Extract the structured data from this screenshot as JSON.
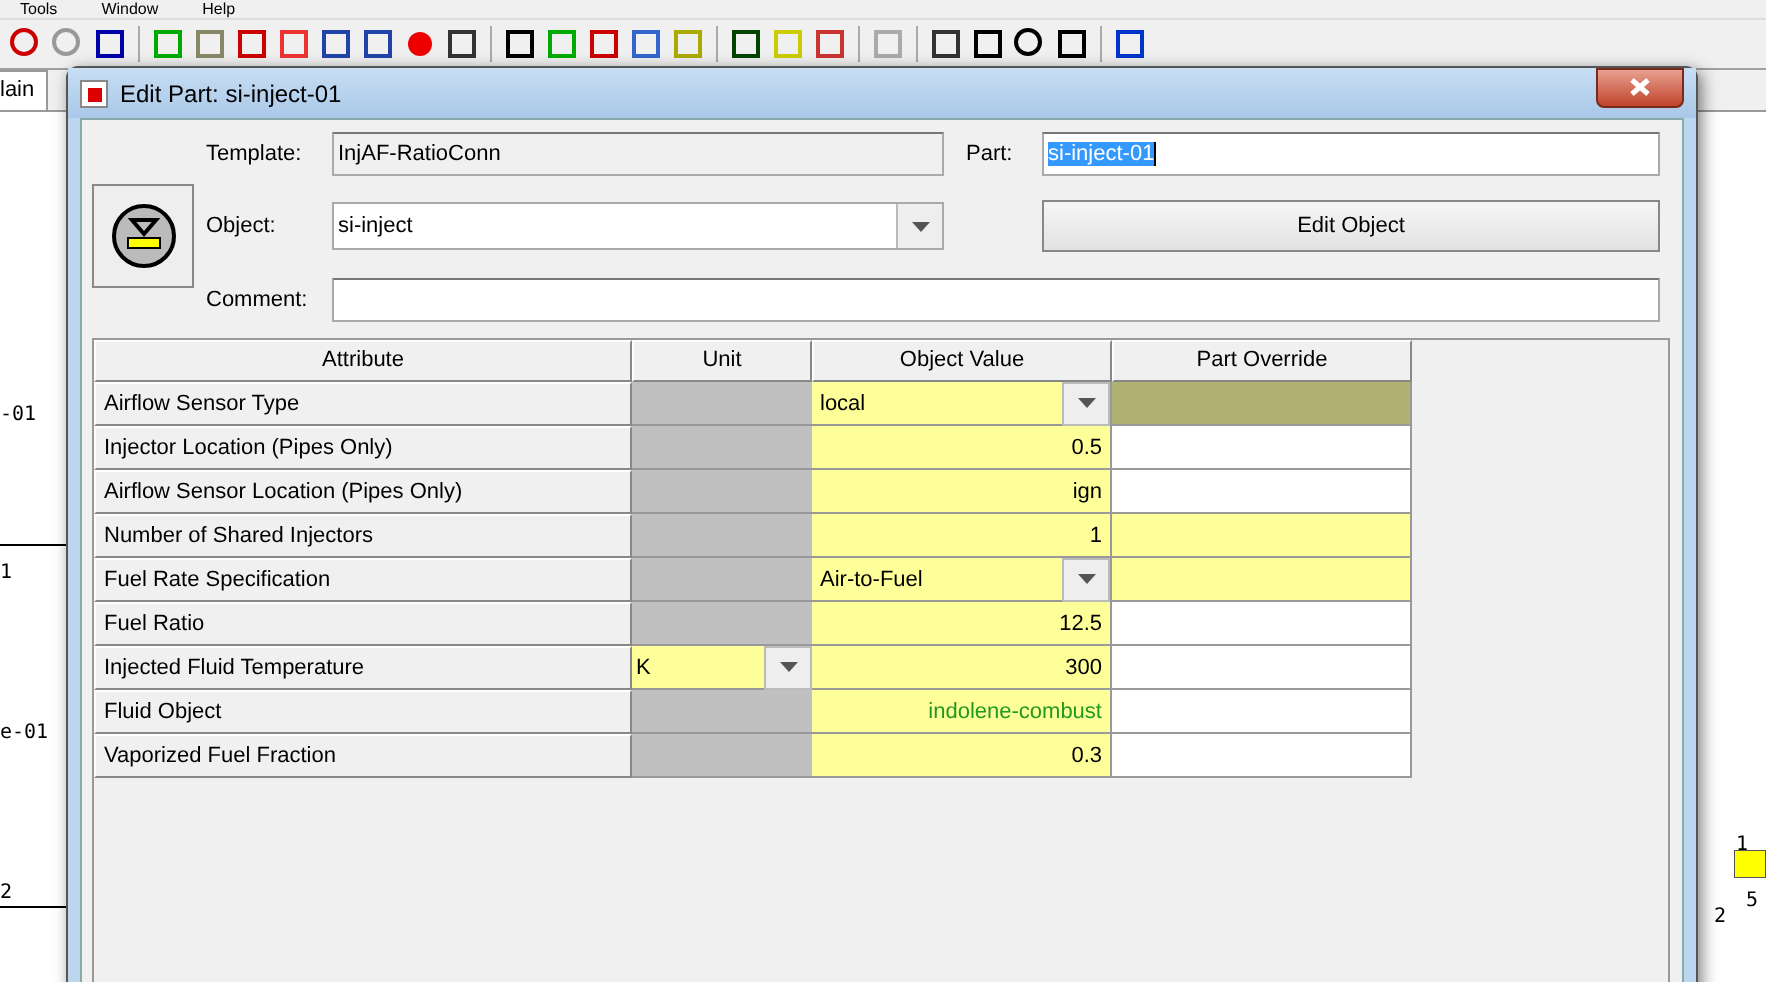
{
  "menu": [
    "Tools",
    "Window",
    "Help"
  ],
  "canvas": {
    "tab": "lain",
    "left_labels": [
      "-01",
      "1",
      "e-01",
      "2"
    ],
    "right_labels": [
      "1",
      "2",
      "5"
    ]
  },
  "dialog": {
    "title": "Edit Part: si-inject-01",
    "template": {
      "label": "Template:",
      "value": "InjAF-RatioConn"
    },
    "part": {
      "label": "Part:",
      "value": "si-inject-01"
    },
    "object": {
      "label": "Object:",
      "value": "si-inject"
    },
    "edit_button": "Edit Object",
    "comment": {
      "label": "Comment:"
    },
    "table": {
      "columns": [
        "Attribute",
        "Unit",
        "Object Value",
        "Part Override"
      ],
      "rows": [
        {
          "attribute": "Airflow Sensor Type",
          "unit": {
            "kind": "none"
          },
          "value": {
            "kind": "dropdown",
            "text": "local"
          },
          "override": {
            "color": "#b0b070"
          }
        },
        {
          "attribute": "Injector Location (Pipes Only)",
          "unit": {
            "kind": "none"
          },
          "value": {
            "kind": "text",
            "text": "0.5"
          },
          "override": {
            "color": "#ffffff"
          }
        },
        {
          "attribute": "Airflow Sensor Location (Pipes Only)",
          "unit": {
            "kind": "none"
          },
          "value": {
            "kind": "text",
            "text": "ign"
          },
          "override": {
            "color": "#ffffff"
          }
        },
        {
          "attribute": "Number of Shared Injectors",
          "unit": {
            "kind": "none"
          },
          "value": {
            "kind": "text",
            "text": "1"
          },
          "override": {
            "color": "#ffff99"
          }
        },
        {
          "attribute": "Fuel Rate Specification",
          "unit": {
            "kind": "none"
          },
          "value": {
            "kind": "dropdown",
            "text": "Air-to-Fuel"
          },
          "override": {
            "color": "#ffff99"
          }
        },
        {
          "attribute": "Fuel Ratio",
          "unit": {
            "kind": "none"
          },
          "value": {
            "kind": "text",
            "text": "12.5"
          },
          "override": {
            "color": "#ffffff"
          }
        },
        {
          "attribute": "Injected Fluid Temperature",
          "unit": {
            "kind": "dropdown",
            "text": "K"
          },
          "value": {
            "kind": "text",
            "text": "300"
          },
          "override": {
            "color": "#ffffff"
          }
        },
        {
          "attribute": "Fluid Object",
          "unit": {
            "kind": "none"
          },
          "value": {
            "kind": "reference",
            "text": "indolene-combust"
          },
          "override": {
            "color": "#ffffff"
          }
        },
        {
          "attribute": "Vaporized Fuel Fraction",
          "unit": {
            "kind": "none"
          },
          "value": {
            "kind": "text",
            "text": "0.3"
          },
          "override": {
            "color": "#ffffff"
          }
        }
      ]
    }
  }
}
